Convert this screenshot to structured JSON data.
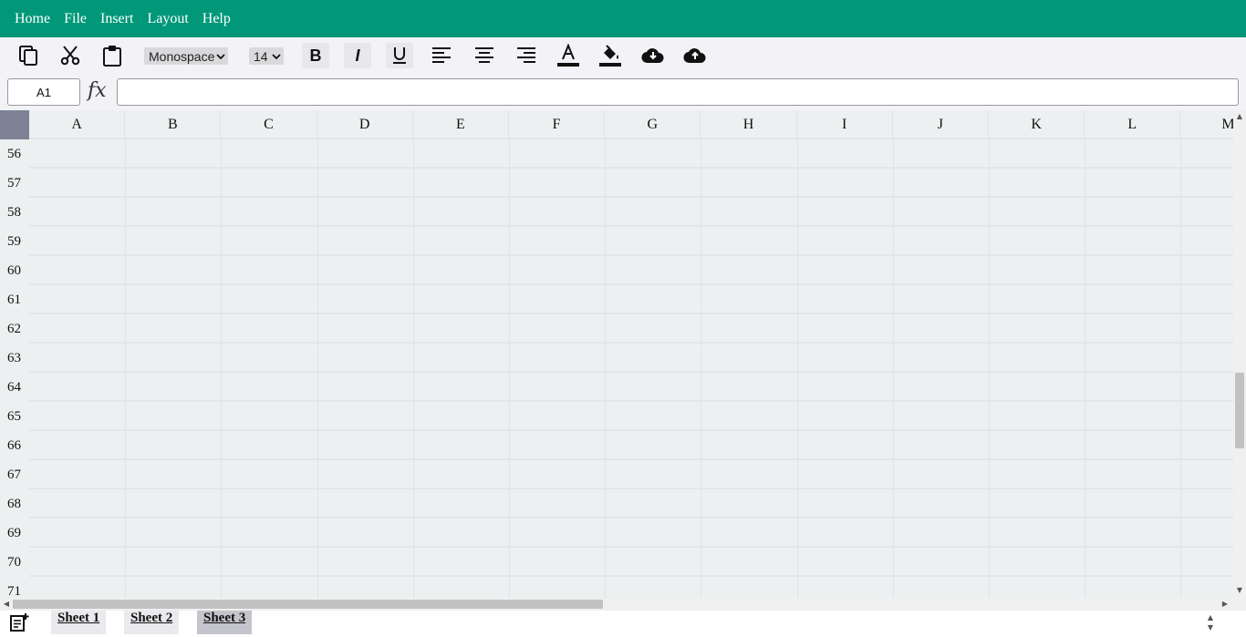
{
  "menu": [
    "Home",
    "File",
    "Insert",
    "Layout",
    "Help"
  ],
  "toolbar": {
    "icons": [
      "copy-icon",
      "cut-icon",
      "paste-icon",
      "bold-icon",
      "italic-icon",
      "underline-icon",
      "align-left-icon",
      "align-center-icon",
      "align-right-icon",
      "text-color-icon",
      "fill-color-icon",
      "download-icon",
      "upload-icon"
    ],
    "font_family": "Monospace",
    "font_size": "14"
  },
  "formula_bar": {
    "cell_ref": "A1",
    "fx_label": "fx",
    "formula_value": ""
  },
  "grid": {
    "columns": [
      "A",
      "B",
      "C",
      "D",
      "E",
      "F",
      "G",
      "H",
      "I",
      "J",
      "K",
      "L",
      "M"
    ],
    "rows": [
      "56",
      "57",
      "58",
      "59",
      "60",
      "61",
      "62",
      "63",
      "64",
      "65",
      "66",
      "67",
      "68",
      "69",
      "70",
      "71"
    ]
  },
  "sheets": {
    "tabs": [
      "Sheet 1",
      "Sheet 2",
      "Sheet 3"
    ],
    "active": "Sheet 3"
  }
}
